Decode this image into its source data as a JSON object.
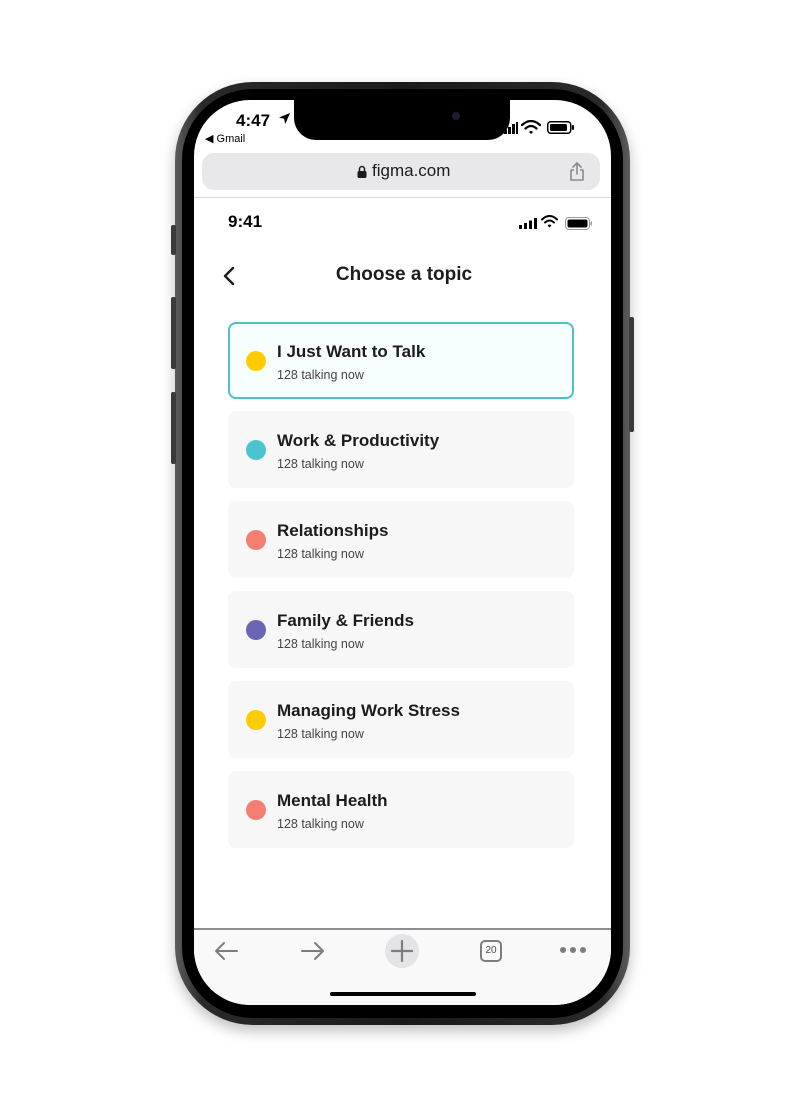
{
  "browser": {
    "status_time": "4:47",
    "back_app_label": "◀ Gmail",
    "url": "figma.com",
    "tabs_count": "20"
  },
  "app": {
    "status_time": "9:41",
    "title": "Choose a topic",
    "topics": [
      {
        "title": "I Just Want to Talk",
        "subtitle": "128 talking now",
        "color": "#ffcc00",
        "selected": true
      },
      {
        "title": "Work & Productivity",
        "subtitle": "128 talking now",
        "color": "#4cc3cf",
        "selected": false
      },
      {
        "title": "Relationships",
        "subtitle": "128 talking now",
        "color": "#f37e72",
        "selected": false
      },
      {
        "title": "Family & Friends",
        "subtitle": "128 talking now",
        "color": "#6a65b5",
        "selected": false
      },
      {
        "title": "Managing Work Stress",
        "subtitle": "128 talking now",
        "color": "#ffcc00",
        "selected": false
      },
      {
        "title": "Mental Health",
        "subtitle": "128 talking now",
        "color": "#f37e72",
        "selected": false
      }
    ]
  },
  "icons": {
    "location": "location-arrow-icon",
    "signal": "cellular-signal-icon",
    "wifi": "wifi-icon",
    "battery": "battery-icon",
    "lock": "lock-icon",
    "share": "share-icon",
    "back": "chevron-left-icon",
    "browser_back": "arrow-left-icon",
    "browser_forward": "arrow-right-icon",
    "new_tab": "plus-icon",
    "tabs": "tabs-icon",
    "more": "more-dots-icon"
  },
  "colors": {
    "selected_border": "#4fbfca",
    "card_background": "#f7f7f7"
  }
}
